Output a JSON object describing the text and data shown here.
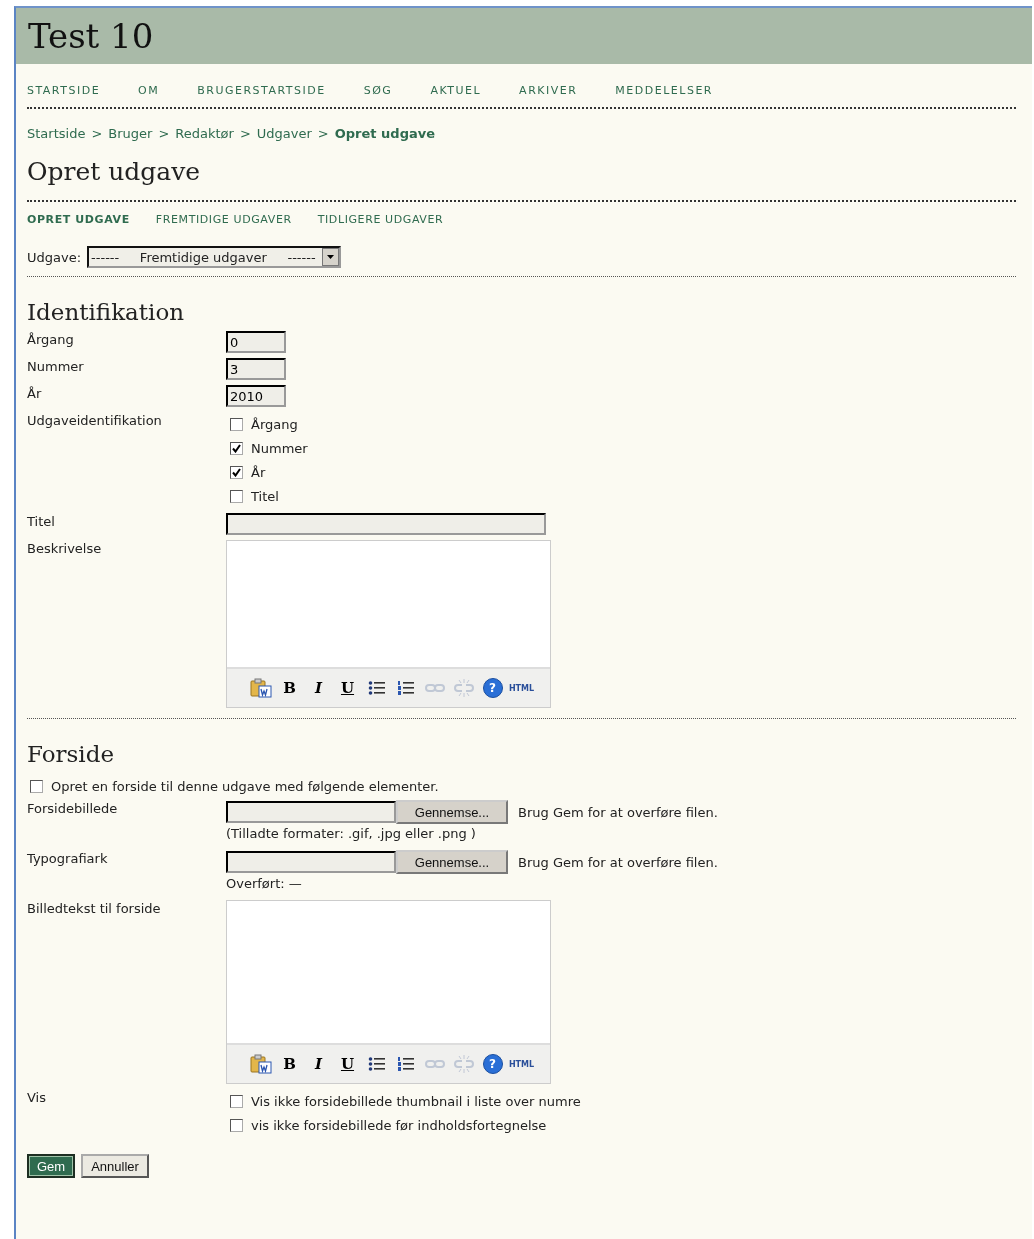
{
  "site_title": "Test 10",
  "nav": [
    {
      "label": "STARTSIDE"
    },
    {
      "label": "OM"
    },
    {
      "label": "BRUGERSTARTSIDE"
    },
    {
      "label": "SØG"
    },
    {
      "label": "AKTUEL"
    },
    {
      "label": "ARKIVER"
    },
    {
      "label": "MEDDELELSER"
    }
  ],
  "breadcrumb": [
    {
      "label": "Startside",
      "current": false
    },
    {
      "label": "Bruger",
      "current": false
    },
    {
      "label": "Redaktør",
      "current": false
    },
    {
      "label": "Udgaver",
      "current": false
    },
    {
      "label": "Opret udgave",
      "current": true
    }
  ],
  "breadcrumb_separator": ">",
  "page_title": "Opret udgave",
  "tabs": [
    {
      "label": "OPRET UDGAVE",
      "selected": true
    },
    {
      "label": "FREMTIDIGE UDGAVER",
      "selected": false
    },
    {
      "label": "TIDLIGERE UDGAVER",
      "selected": false
    }
  ],
  "issue_select": {
    "label": "Udgave:",
    "value": "------     Fremtidige udgaver     ------"
  },
  "sections": [
    {
      "heading": "Identifikation",
      "fields": [
        {
          "kind": "short",
          "label": "Årgang",
          "value": "0"
        },
        {
          "kind": "short",
          "label": "Nummer",
          "value": "3"
        },
        {
          "kind": "short",
          "label": "År",
          "value": "2010"
        },
        {
          "kind": "checkboxes",
          "label": "Udgaveidentifikation",
          "options": [
            {
              "label": "Årgang",
              "checked": false
            },
            {
              "label": "Nummer",
              "checked": true
            },
            {
              "label": "År",
              "checked": true
            },
            {
              "label": "Titel",
              "checked": false
            }
          ]
        },
        {
          "kind": "long",
          "label": "Titel"
        },
        {
          "kind": "editor",
          "label": "Beskrivelse",
          "toolbar": [
            {
              "kind": "paste",
              "disabled": false
            },
            {
              "kind": "bold",
              "label": "B",
              "disabled": false
            },
            {
              "kind": "italic",
              "label": "I",
              "disabled": false
            },
            {
              "kind": "underline",
              "label": "U",
              "disabled": false
            },
            {
              "kind": "bullets",
              "disabled": false
            },
            {
              "kind": "numbers",
              "disabled": false
            },
            {
              "kind": "link",
              "disabled": true
            },
            {
              "kind": "unlink",
              "disabled": true
            },
            {
              "kind": "help",
              "label": "?",
              "disabled": false
            },
            {
              "kind": "html",
              "label": "HTML",
              "disabled": false
            }
          ]
        }
      ]
    },
    {
      "heading": "Forside",
      "enable": {
        "label": "Opret en forside til denne udgave med følgende elementer.",
        "checked": false
      },
      "fields": [
        {
          "kind": "file",
          "label": "Forsidebillede",
          "button": "Gennemse...",
          "note": "Brug Gem for at overføre filen.",
          "hint": "(Tilladte formater: .gif, .jpg eller .png )"
        },
        {
          "kind": "file",
          "label": "Typografiark",
          "button": "Gennemse...",
          "note": "Brug Gem for at overføre filen.",
          "hint": "Overført: —"
        },
        {
          "kind": "editor",
          "label": "Billedtekst til forside",
          "toolbar": [
            {
              "kind": "paste",
              "disabled": false
            },
            {
              "kind": "bold",
              "label": "B",
              "disabled": false
            },
            {
              "kind": "italic",
              "label": "I",
              "disabled": false
            },
            {
              "kind": "underline",
              "label": "U",
              "disabled": false
            },
            {
              "kind": "bullets",
              "disabled": false
            },
            {
              "kind": "numbers",
              "disabled": false
            },
            {
              "kind": "link",
              "disabled": true
            },
            {
              "kind": "unlink",
              "disabled": true
            },
            {
              "kind": "help",
              "label": "?",
              "disabled": false
            },
            {
              "kind": "html",
              "label": "HTML",
              "disabled": false
            }
          ]
        },
        {
          "kind": "checkboxes",
          "label": "Vis",
          "options": [
            {
              "label": "Vis ikke forsidebillede thumbnail i liste over numre",
              "checked": false
            },
            {
              "label": "vis ikke forsidebillede før indholdsfortegnelse",
              "checked": false
            }
          ]
        }
      ]
    }
  ],
  "buttons": [
    {
      "label": "Gem",
      "kind": "primary"
    },
    {
      "label": "Annuller",
      "kind": "secondary"
    }
  ]
}
